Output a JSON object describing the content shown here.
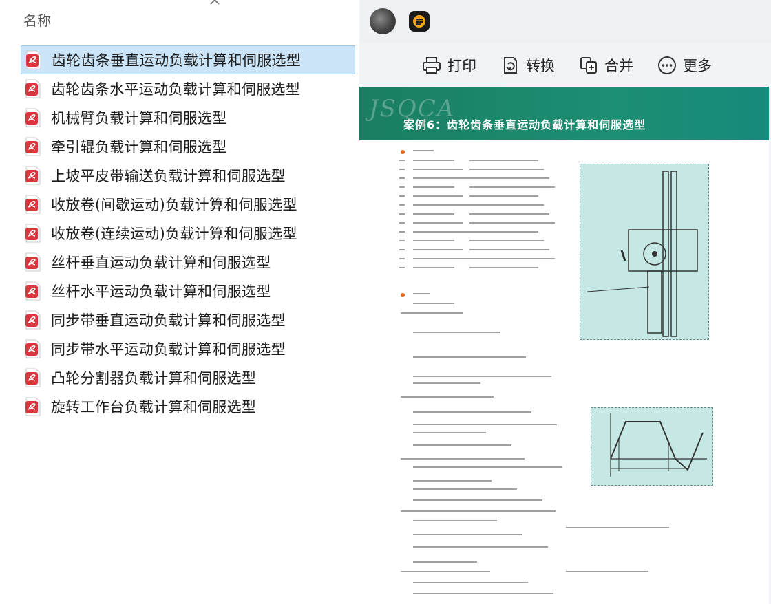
{
  "list_header": "名称",
  "files": [
    {
      "name": "齿轮齿条垂直运动负载计算和伺服选型",
      "selected": true
    },
    {
      "name": "齿轮齿条水平运动负载计算和伺服选型",
      "selected": false
    },
    {
      "name": "机械臂负载计算和伺服选型",
      "selected": false
    },
    {
      "name": "牵引辊负载计算和伺服选型",
      "selected": false
    },
    {
      "name": "上坡平皮带输送负载计算和伺服选型",
      "selected": false
    },
    {
      "name": "收放卷(间歇运动)负载计算和伺服选型",
      "selected": false
    },
    {
      "name": "收放卷(连续运动)负载计算和伺服选型",
      "selected": false
    },
    {
      "name": "丝杆垂直运动负载计算和伺服选型",
      "selected": false
    },
    {
      "name": "丝杆水平运动负载计算和伺服选型",
      "selected": false
    },
    {
      "name": "同步带垂直运动负载计算和伺服选型",
      "selected": false
    },
    {
      "name": "同步带水平运动负载计算和伺服选型",
      "selected": false
    },
    {
      "name": "凸轮分割器负载计算和伺服选型",
      "selected": false
    },
    {
      "name": "旋转工作台负载计算和伺服选型",
      "selected": false
    }
  ],
  "toolbar": {
    "print_label": "打印",
    "convert_label": "转换",
    "merge_label": "合并",
    "more_label": "更多"
  },
  "preview": {
    "banner_logo": "JSQCA",
    "banner_title": "案例6：齿轮齿条垂直运动负载计算和伺服选型"
  },
  "icons": {
    "sort": "chevron-up-icon",
    "file": "pdf-file-icon",
    "print": "printer-icon",
    "convert": "convert-icon",
    "merge": "merge-icon",
    "more": "more-icon"
  },
  "colors": {
    "selection": "#cce4f7",
    "banner": "#1a7e62",
    "pdf_red": "#d9363e",
    "figure_bg": "#c6e8e4"
  }
}
